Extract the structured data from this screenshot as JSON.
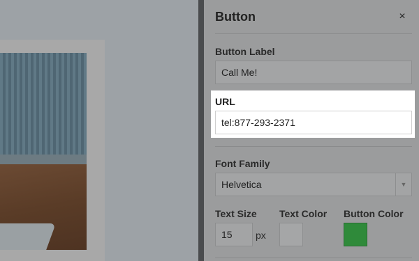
{
  "panel": {
    "title": "Button",
    "close_glyph": "×",
    "button_label": {
      "label": "Button Label",
      "value": "Call Me!"
    },
    "url": {
      "label": "URL",
      "value": "tel:877-293-2371"
    },
    "font_family": {
      "label": "Font Family",
      "selected": "Helvetica"
    },
    "text_size": {
      "label": "Text Size",
      "value": "15",
      "unit": "px"
    },
    "text_color": {
      "label": "Text Color",
      "color": "#a5a6a7"
    },
    "button_color": {
      "label": "Button Color",
      "color": "#2f8a3a"
    }
  },
  "icons": {
    "close": "close-icon",
    "select_arrow": "chevron-down-icon"
  }
}
